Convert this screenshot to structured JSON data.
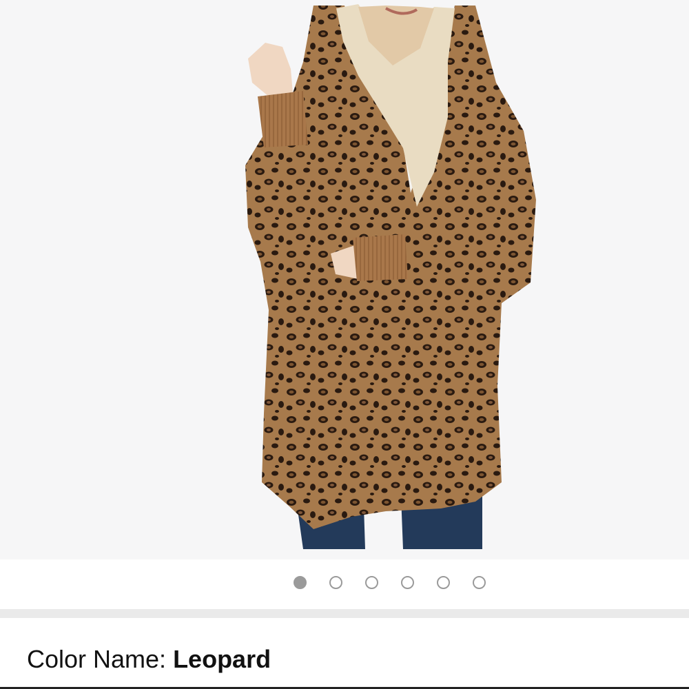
{
  "product_image": {
    "description_icon": "product-photo"
  },
  "carousel": {
    "total": 6,
    "active_index": 0,
    "dot_color": "#9a9a9a"
  },
  "variation": {
    "label": "Color Name: ",
    "value": "Leopard"
  }
}
